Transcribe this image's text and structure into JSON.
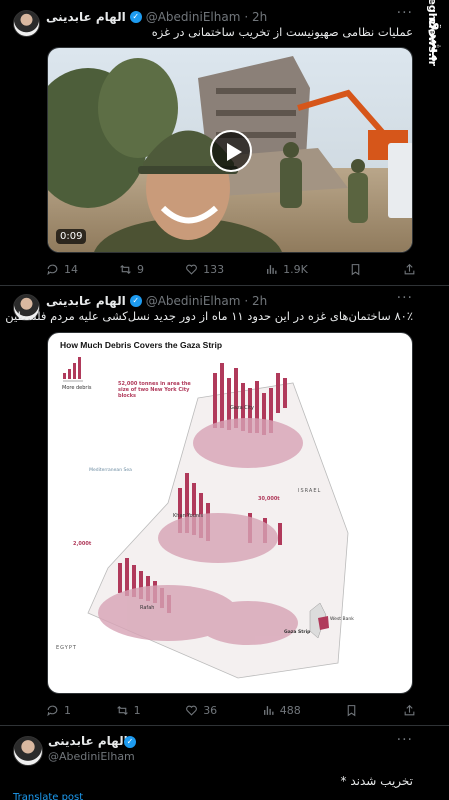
{
  "watermark": {
    "site": "mashreghnews.ir",
    "logo": "مشرق"
  },
  "tweets": [
    {
      "name": "الهام عابدینی",
      "handle": "@AbediniElham",
      "time": "· 2h",
      "text": "عملیات نظامی صهیونیست از تخریب ساختمانی در غزه",
      "video_duration": "0:09",
      "replies": "14",
      "retweets": "9",
      "likes": "133",
      "views": "1.9K"
    },
    {
      "name": "الهام عابدینی",
      "handle": "@AbediniElham",
      "time": "· 2h",
      "text": "۸۰٪ ساختمان‌های غزه در این حدود ۱۱ ماه از دور جدید نسل‌کشی علیه مردم فلسطین",
      "replies": "1",
      "retweets": "1",
      "likes": "36",
      "views": "488",
      "infographic": {
        "title": "How Much Debris Covers the Gaza Strip",
        "legend_label": "More debris",
        "callout_main": "52,000 tonnes in area the size of two New York City blocks",
        "callout_30000": "30,000t",
        "callout_2000": "2,000t",
        "label_gaza_city": "Gaza City",
        "label_khan_younis": "Khan Younis",
        "label_rafah": "Rafah",
        "label_sea": "Mediterranean Sea",
        "label_israel": "ISRAEL",
        "label_egypt": "EGYPT",
        "label_west_bank": "West Bank",
        "label_gaza_strip": "Gaza Strip"
      }
    },
    {
      "name": "الهام عابدینی",
      "handle": "@AbediniElham",
      "text": "تخریب شدند *",
      "translate": "Translate post"
    }
  ]
}
